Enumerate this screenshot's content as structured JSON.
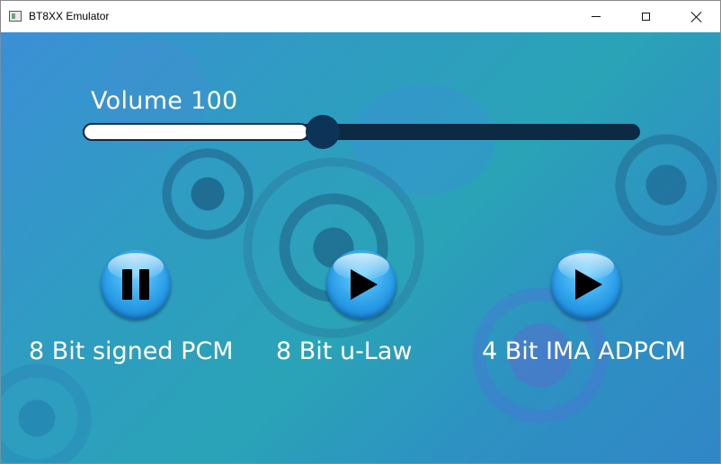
{
  "window": {
    "title": "BT8XX Emulator",
    "controls": {
      "minimize": "minimize-icon",
      "maximize": "maximize-icon",
      "close": "close-icon"
    }
  },
  "volume": {
    "label": "Volume 100",
    "level_fraction": 0.39
  },
  "players": [
    {
      "label": "8 Bit signed PCM",
      "state": "playing",
      "button_icon": "pause-icon"
    },
    {
      "label": "8 Bit u-Law",
      "state": "stopped",
      "button_icon": "play-icon"
    },
    {
      "label": "4 Bit IMA ADPCM",
      "state": "stopped",
      "button_icon": "play-icon"
    }
  ],
  "colors": {
    "track": "#0d2a44",
    "thumb": "#0d3456",
    "button": "#2a9ee8"
  }
}
